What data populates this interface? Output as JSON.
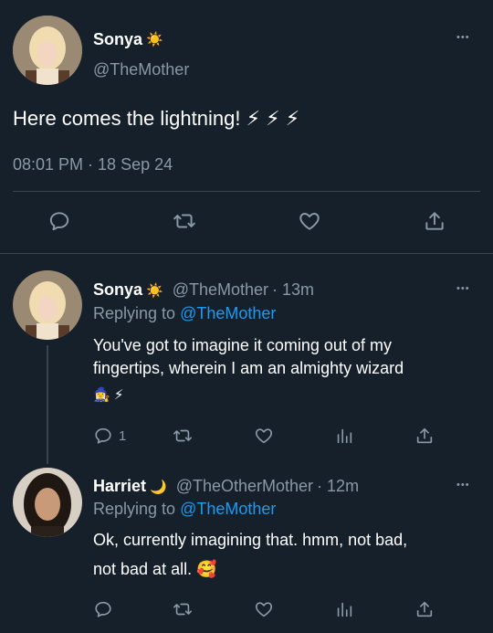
{
  "main_tweet": {
    "author": "Sonya",
    "author_emoji": "☀️",
    "handle": "@TheMother",
    "text": "Here comes the lightning! ⚡ ⚡ ⚡",
    "timestamp": "08:01 PM · 18 Sep 24",
    "more_label": "•••"
  },
  "replies": [
    {
      "author": "Sonya",
      "author_emoji": "☀️",
      "handle": "@TheMother",
      "time": "· 13m",
      "replying_prefix": "Replying to",
      "replying_to": "@TheMother",
      "text_line1": "You've got to imagine it coming out of my",
      "text_line2": "fingertips, wherein I am an almighty wizard",
      "text_line3": "🧙‍♀️ ⚡",
      "reply_count": "1",
      "more_label": "•••"
    },
    {
      "author": "Harriet",
      "author_emoji": "🌙",
      "handle": "@TheOtherMother",
      "time": "· 12m",
      "replying_prefix": "Replying to",
      "replying_to": "@TheMother",
      "text_line1": "Ok, currently imagining that. hmm, not bad,",
      "text_line2": "not bad at all. 🥰",
      "more_label": "•••"
    }
  ],
  "icons": {
    "reply": "comment-bubble-icon",
    "retweet": "retweet-icon",
    "like": "heart-icon",
    "share": "share-upload-icon",
    "analytics": "analytics-bars-icon",
    "more": "more-dots-icon"
  },
  "colors": {
    "background": "#15202b",
    "text": "#ffffff",
    "muted": "#8b98a5",
    "link": "#1d9bf0",
    "divider": "#38444d"
  }
}
